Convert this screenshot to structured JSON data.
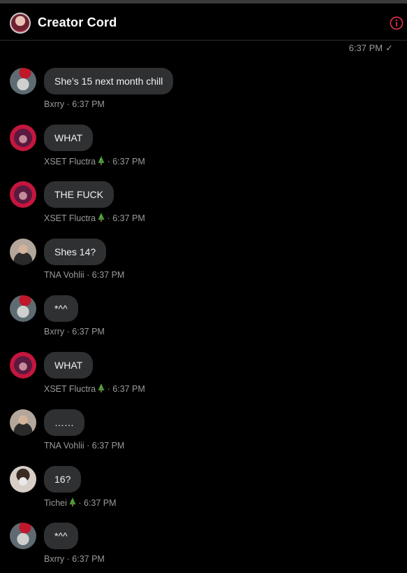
{
  "header": {
    "title": "Creator Cord",
    "sent_time": "6:37 PM"
  },
  "colors": {
    "background": "#000000",
    "bubble": "#2f3032",
    "meta_text": "#9a9a9a",
    "info_icon": "#e0334d"
  },
  "icons": {
    "info": "info-icon",
    "read": "checkmark-icon",
    "tree": "christmas-tree-icon"
  },
  "messages": [
    {
      "text": "She’s 15 next month chill",
      "author": "Bxrry",
      "time": "· 6:37 PM"
    },
    {
      "text": "WHAT",
      "author": "XSET Fluctra",
      "time": "· 6:37 PM"
    },
    {
      "text": "THE FUCK",
      "author": "XSET Fluctra",
      "time": "· 6:37 PM"
    },
    {
      "text": "Shes 14?",
      "author": "TNA Vohlii",
      "time": "· 6:37 PM"
    },
    {
      "text": "*^^",
      "author": "Bxrry",
      "time": "· 6:37 PM"
    },
    {
      "text": "WHAT",
      "author": "XSET Fluctra",
      "time": "· 6:37 PM"
    },
    {
      "text": "……",
      "author": "TNA Vohlii",
      "time": "· 6:37 PM"
    },
    {
      "text": "16?",
      "author": "Tichei",
      "time": "· 6:37 PM"
    },
    {
      "text": "*^^",
      "author": "Bxrry",
      "time": "· 6:37 PM"
    }
  ]
}
